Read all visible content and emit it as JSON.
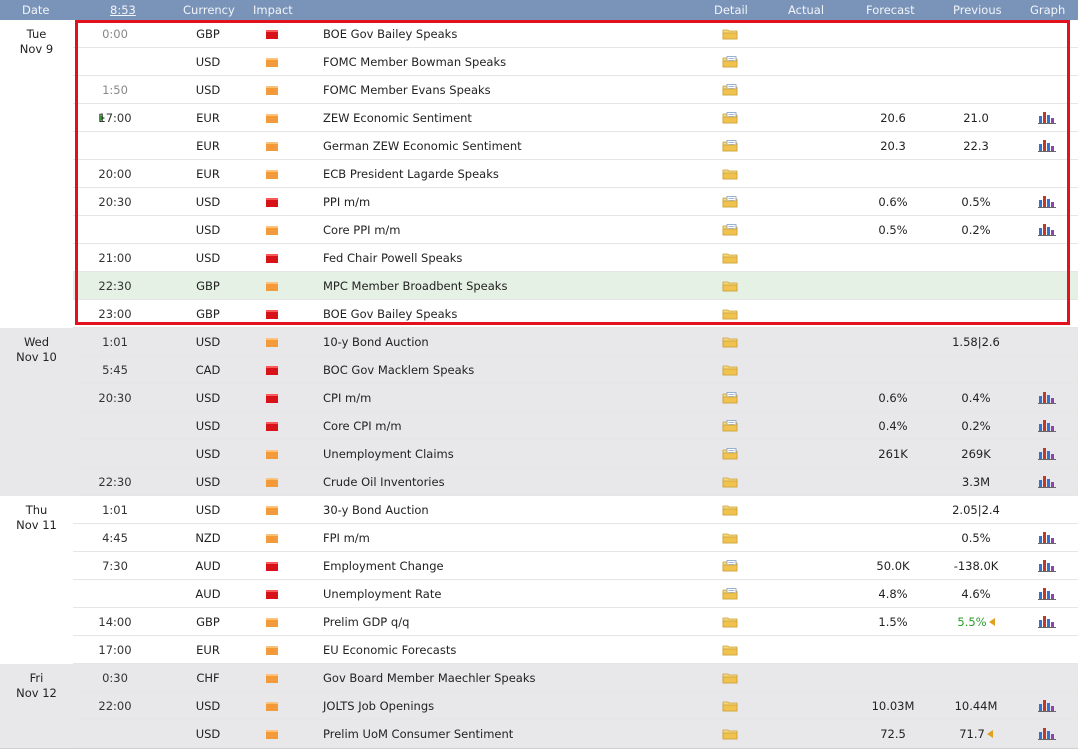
{
  "header": {
    "date": "Date",
    "time": "8:53",
    "currency": "Currency",
    "impact": "Impact",
    "detail": "Detail",
    "actual": "Actual",
    "forecast": "Forecast",
    "previous": "Previous",
    "graph": "Graph"
  },
  "colors": {
    "header_bg": "#7a93b8",
    "high_impact": "#d9121a",
    "medium_impact": "#f39a3a",
    "highlight": "#e4f1e4",
    "selection_box": "#e3101e"
  },
  "days": [
    {
      "day": "Tue",
      "date": "Nov 9",
      "events": [
        {
          "time": "0:00",
          "currency": "GBP",
          "impact": "high",
          "name": "BOE Gov Bailey Speaks",
          "forecast": "",
          "previous": "",
          "graph": false,
          "detail": "plain"
        },
        {
          "time": "",
          "currency": "USD",
          "impact": "medium",
          "name": "FOMC Member Bowman Speaks",
          "forecast": "",
          "previous": "",
          "graph": false,
          "detail": "doc"
        },
        {
          "time": "1:50",
          "currency": "USD",
          "impact": "medium",
          "name": "FOMC Member Evans Speaks",
          "forecast": "",
          "previous": "",
          "graph": false,
          "detail": "doc"
        },
        {
          "time": "17:00",
          "currency": "EUR",
          "impact": "medium",
          "name": "ZEW Economic Sentiment",
          "forecast": "20.6",
          "previous": "21.0",
          "graph": true,
          "detail": "doc",
          "next": true
        },
        {
          "time": "",
          "currency": "EUR",
          "impact": "medium",
          "name": "German ZEW Economic Sentiment",
          "forecast": "20.3",
          "previous": "22.3",
          "graph": true,
          "detail": "doc"
        },
        {
          "time": "20:00",
          "currency": "EUR",
          "impact": "medium",
          "name": "ECB President Lagarde Speaks",
          "forecast": "",
          "previous": "",
          "graph": false,
          "detail": "plain"
        },
        {
          "time": "20:30",
          "currency": "USD",
          "impact": "high",
          "name": "PPI m/m",
          "forecast": "0.6%",
          "previous": "0.5%",
          "graph": true,
          "detail": "doc"
        },
        {
          "time": "",
          "currency": "USD",
          "impact": "medium",
          "name": "Core PPI m/m",
          "forecast": "0.5%",
          "previous": "0.2%",
          "graph": true,
          "detail": "doc"
        },
        {
          "time": "21:00",
          "currency": "USD",
          "impact": "high",
          "name": "Fed Chair Powell Speaks",
          "forecast": "",
          "previous": "",
          "graph": false,
          "detail": "plain"
        },
        {
          "time": "22:30",
          "currency": "GBP",
          "impact": "medium",
          "name": "MPC Member Broadbent Speaks",
          "forecast": "",
          "previous": "",
          "graph": false,
          "detail": "plain",
          "highlight": true
        },
        {
          "time": "23:00",
          "currency": "GBP",
          "impact": "high",
          "name": "BOE Gov Bailey Speaks",
          "forecast": "",
          "previous": "",
          "graph": false,
          "detail": "plain"
        }
      ]
    },
    {
      "day": "Wed",
      "date": "Nov 10",
      "events": [
        {
          "time": "1:01",
          "currency": "USD",
          "impact": "medium",
          "name": "10-y Bond Auction",
          "forecast": "",
          "previous": "1.58|2.6",
          "graph": false,
          "detail": "plain"
        },
        {
          "time": "5:45",
          "currency": "CAD",
          "impact": "high",
          "name": "BOC Gov Macklem Speaks",
          "forecast": "",
          "previous": "",
          "graph": false,
          "detail": "plain"
        },
        {
          "time": "20:30",
          "currency": "USD",
          "impact": "high",
          "name": "CPI m/m",
          "forecast": "0.6%",
          "previous": "0.4%",
          "graph": true,
          "detail": "doc"
        },
        {
          "time": "",
          "currency": "USD",
          "impact": "high",
          "name": "Core CPI m/m",
          "forecast": "0.4%",
          "previous": "0.2%",
          "graph": true,
          "detail": "doc"
        },
        {
          "time": "",
          "currency": "USD",
          "impact": "medium",
          "name": "Unemployment Claims",
          "forecast": "261K",
          "previous": "269K",
          "graph": true,
          "detail": "doc"
        },
        {
          "time": "22:30",
          "currency": "USD",
          "impact": "medium",
          "name": "Crude Oil Inventories",
          "forecast": "",
          "previous": "3.3M",
          "graph": true,
          "detail": "plain"
        }
      ]
    },
    {
      "day": "Thu",
      "date": "Nov 11",
      "events": [
        {
          "time": "1:01",
          "currency": "USD",
          "impact": "medium",
          "name": "30-y Bond Auction",
          "forecast": "",
          "previous": "2.05|2.4",
          "graph": false,
          "detail": "plain"
        },
        {
          "time": "4:45",
          "currency": "NZD",
          "impact": "medium",
          "name": "FPI m/m",
          "forecast": "",
          "previous": "0.5%",
          "graph": true,
          "detail": "plain"
        },
        {
          "time": "7:30",
          "currency": "AUD",
          "impact": "high",
          "name": "Employment Change",
          "forecast": "50.0K",
          "previous": "-138.0K",
          "graph": true,
          "detail": "doc"
        },
        {
          "time": "",
          "currency": "AUD",
          "impact": "high",
          "name": "Unemployment Rate",
          "forecast": "4.8%",
          "previous": "4.6%",
          "graph": true,
          "detail": "doc"
        },
        {
          "time": "14:00",
          "currency": "GBP",
          "impact": "medium",
          "name": "Prelim GDP q/q",
          "forecast": "1.5%",
          "previous": "5.5%",
          "graph": true,
          "detail": "plain",
          "prev_revised": true
        },
        {
          "time": "17:00",
          "currency": "EUR",
          "impact": "medium",
          "name": "EU Economic Forecasts",
          "forecast": "",
          "previous": "",
          "graph": false,
          "detail": "plain"
        }
      ]
    },
    {
      "day": "Fri",
      "date": "Nov 12",
      "events": [
        {
          "time": "0:30",
          "currency": "CHF",
          "impact": "medium",
          "name": "Gov Board Member Maechler Speaks",
          "forecast": "",
          "previous": "",
          "graph": false,
          "detail": "plain"
        },
        {
          "time": "22:00",
          "currency": "USD",
          "impact": "medium",
          "name": "JOLTS Job Openings",
          "forecast": "10.03M",
          "previous": "10.44M",
          "graph": true,
          "detail": "plain"
        },
        {
          "time": "",
          "currency": "USD",
          "impact": "medium",
          "name": "Prelim UoM Consumer Sentiment",
          "forecast": "72.5",
          "previous": "71.7",
          "graph": true,
          "detail": "plain",
          "prev_revised": true
        }
      ]
    }
  ]
}
